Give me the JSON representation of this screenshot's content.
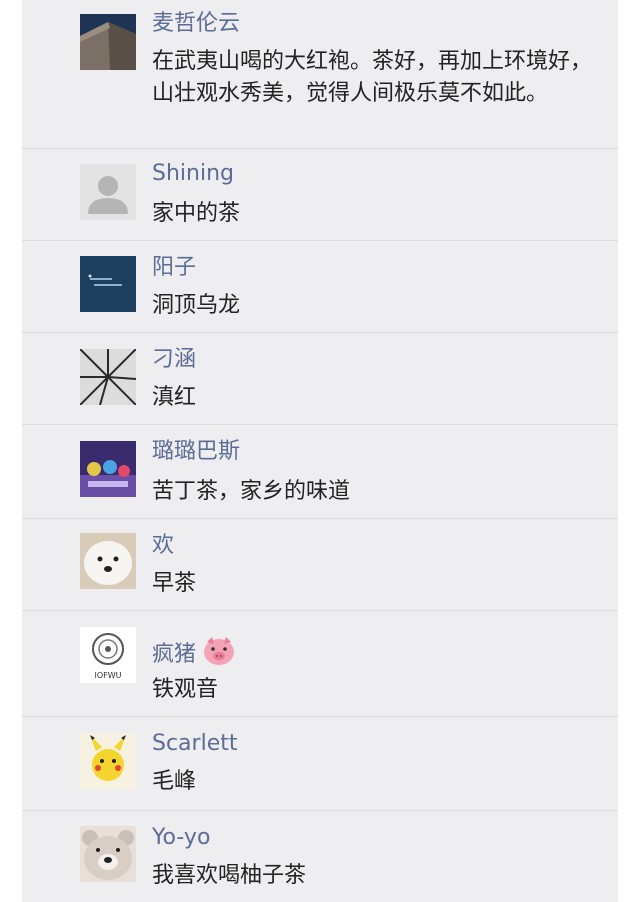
{
  "comments": [
    {
      "name": "麦哲伦云",
      "text": "在武夷山喝的大红袍。茶好，再加上环境好，山壮观水秀美，觉得人间极乐莫不如此。",
      "avatar": "castle-wall-photo"
    },
    {
      "name": "Shining",
      "text": "家中的茶",
      "avatar": "default-person-icon"
    },
    {
      "name": "阳子",
      "text": "洞顶乌龙",
      "avatar": "dark-blue-text-image"
    },
    {
      "name": "刁涵",
      "text": "滇红",
      "avatar": "bw-tree-canopy-photo"
    },
    {
      "name": "璐璐巴斯",
      "text": "苦丁茶，家乡的味道",
      "avatar": "animated-characters-image"
    },
    {
      "name": "欢",
      "text": "早茶",
      "avatar": "white-dog-photo"
    },
    {
      "name": "疯猪",
      "text": "铁观音",
      "avatar": "medallion-logo",
      "avatar_caption": "IOFWU",
      "name_emoji": "pig-face-emoji"
    },
    {
      "name": "Scarlett",
      "text": "毛峰",
      "avatar": "pikachu-image"
    },
    {
      "name": "Yo-yo",
      "text": "我喜欢喝柚子茶",
      "avatar": "bear-plush-photo"
    }
  ]
}
